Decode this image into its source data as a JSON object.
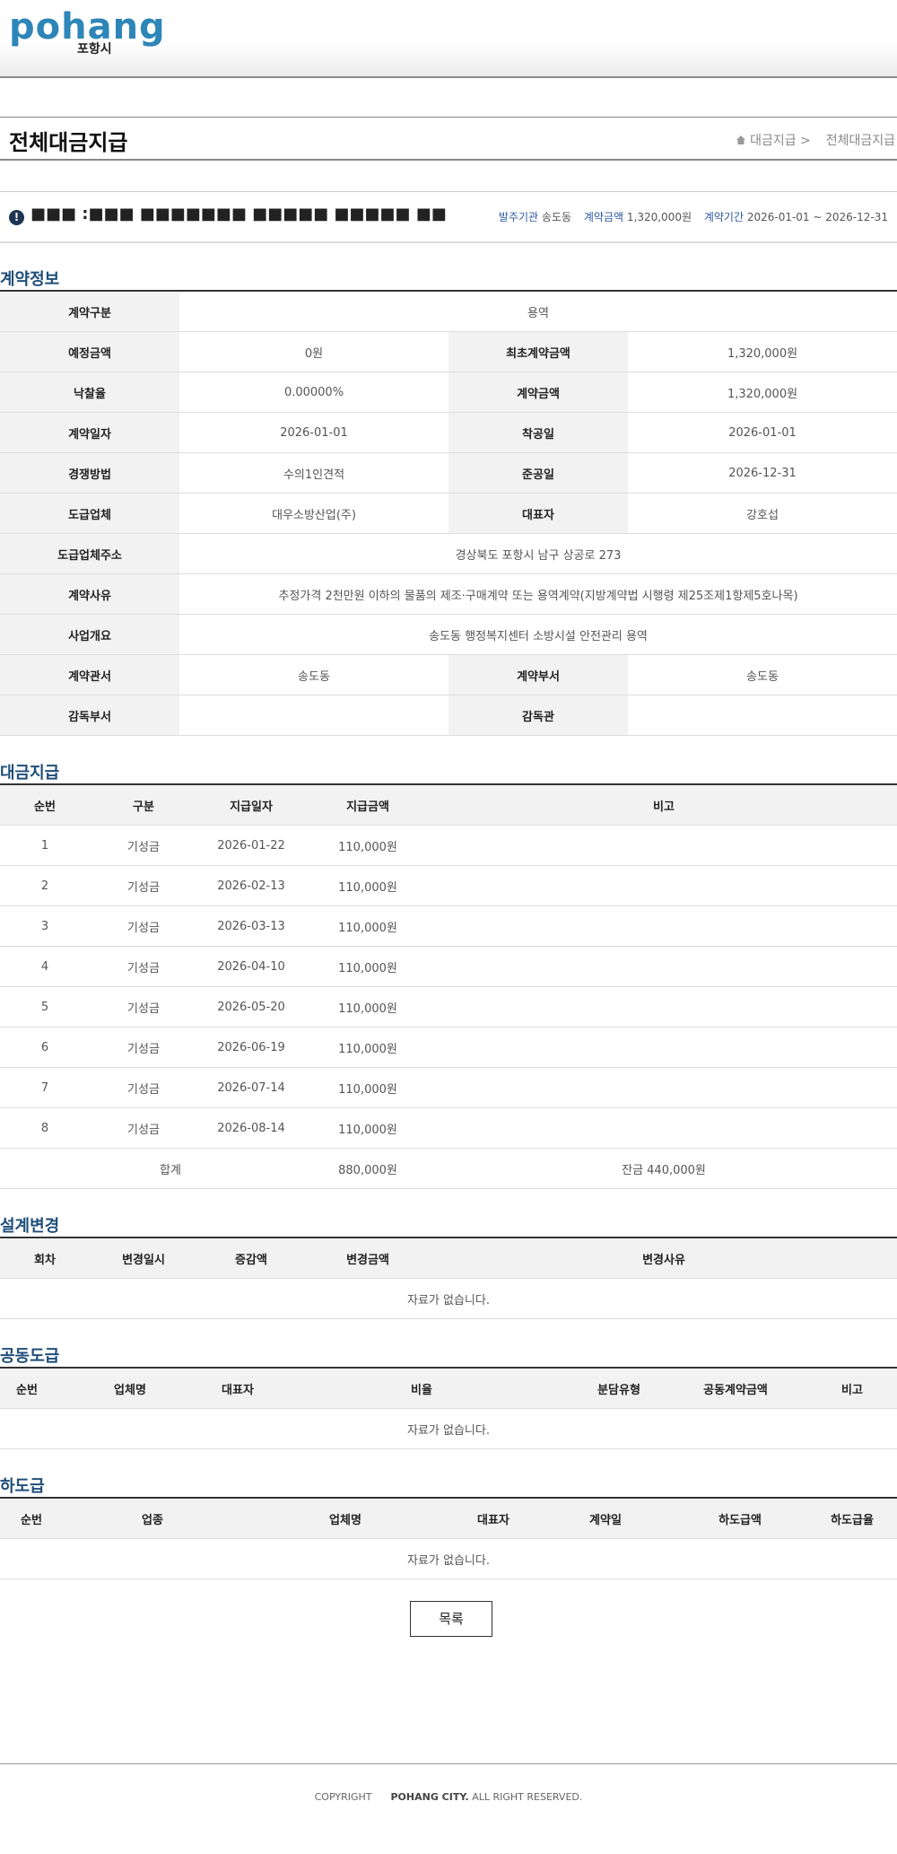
{
  "header": {
    "logo_text": "pohang",
    "logo_sub": "포항시"
  },
  "page": {
    "title": "전체대금지급",
    "breadcrumb": {
      "section": "대금지급",
      "separator": ">",
      "current": "전체대금지급"
    }
  },
  "contract": {
    "name": "■■■ :■■■ ■■■■■■■ ■■■■■ ■■■■■ ■■",
    "meta_org_label": "발주기관",
    "meta_org": "송도동",
    "meta_amount_label": "계약금액",
    "meta_amount": "1,320,000원",
    "meta_period_label": "계약기간",
    "meta_period": "2026-01-01 ~ 2026-12-31"
  },
  "info": {
    "title": "계약정보",
    "rows": [
      [
        {
          "label": "계약구분",
          "value": "용역"
        }
      ],
      [
        {
          "label": "예정금액",
          "value": "0원"
        },
        {
          "label": "최초계약금액",
          "value": "1,320,000원"
        }
      ],
      [
        {
          "label": "낙찰율",
          "value": "0.00000%"
        },
        {
          "label": "계약금액",
          "value": "1,320,000원"
        }
      ],
      [
        {
          "label": "계약일자",
          "value": "2026-01-01"
        },
        {
          "label": "착공일",
          "value": "2026-01-01"
        }
      ],
      [
        {
          "label": "경쟁방법",
          "value": "수의1인견적"
        },
        {
          "label": "준공일",
          "value": "2026-12-31"
        }
      ],
      [
        {
          "label": "도급업체",
          "value": "대우소방산업(주)"
        },
        {
          "label": "대표자",
          "value": "강호섭"
        }
      ],
      [
        {
          "label": "도급업체주소",
          "value": "경상북도 포항시 남구 상공로 273"
        }
      ],
      [
        {
          "label": "계약사유",
          "value": "추정가격 2천만원 이하의 물품의 제조·구매계약 또는 용역계약(지방계약법 시행령 제25조제1항제5호나목)"
        }
      ],
      [
        {
          "label": "사업개요",
          "value": "송도동 행정복지센터 소방시설 안전관리 용역"
        }
      ],
      [
        {
          "label": "계약관서",
          "value": "송도동"
        },
        {
          "label": "계약부서",
          "value": "송도동"
        }
      ],
      [
        {
          "label": "감독부서",
          "value": ""
        },
        {
          "label": "감독관",
          "value": ""
        }
      ]
    ]
  },
  "payments": {
    "title": "대금지급",
    "headers": [
      "순번",
      "구분",
      "지급일자",
      "지급금액",
      "비고"
    ],
    "rows": [
      [
        "1",
        "기성금",
        "2026-01-22",
        "110,000원",
        ""
      ],
      [
        "2",
        "기성금",
        "2026-02-13",
        "110,000원",
        ""
      ],
      [
        "3",
        "기성금",
        "2026-03-13",
        "110,000원",
        ""
      ],
      [
        "4",
        "기성금",
        "2026-04-10",
        "110,000원",
        ""
      ],
      [
        "5",
        "기성금",
        "2026-05-20",
        "110,000원",
        ""
      ],
      [
        "6",
        "기성금",
        "2026-06-19",
        "110,000원",
        ""
      ],
      [
        "7",
        "기성금",
        "2026-07-14",
        "110,000원",
        ""
      ],
      [
        "8",
        "기성금",
        "2026-08-14",
        "110,000원",
        ""
      ]
    ],
    "total_label": "합계",
    "total_amount": "880,000원",
    "balance": "잔금 440,000원"
  },
  "design_change": {
    "title": "설계변경",
    "headers": [
      "회차",
      "변경일시",
      "증감액",
      "변경금액",
      "변경사유"
    ],
    "empty": "자료가 없습니다."
  },
  "joint": {
    "title": "공동도급",
    "headers": [
      "순번",
      "업체명",
      "대표자",
      "비율",
      "분담유형",
      "공동계약금액",
      "비고"
    ],
    "empty": "자료가 없습니다."
  },
  "subcontract": {
    "title": "하도급",
    "headers": [
      "순번",
      "업종",
      "업체명",
      "대표자",
      "계약일",
      "하도급액",
      "하도급율"
    ],
    "empty": "자료가 없습니다."
  },
  "actions": {
    "list_button": "목록"
  },
  "footer": {
    "copyright": "COPYRIGHT",
    "org": "POHANG CITY.",
    "rights": "ALL RIGHT RESERVED."
  }
}
